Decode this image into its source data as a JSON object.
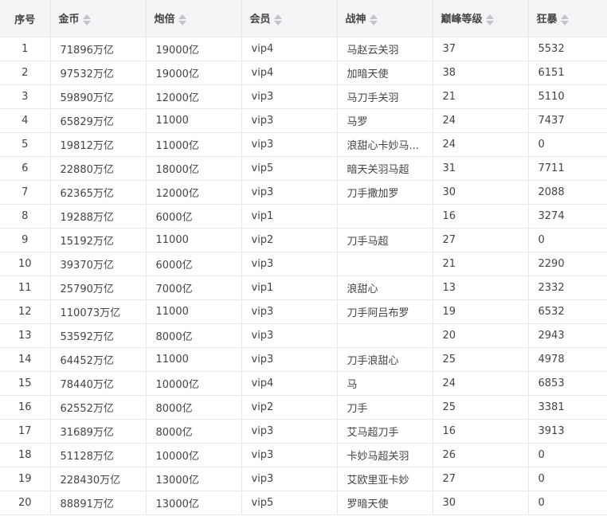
{
  "table": {
    "columns": [
      {
        "label": "序号",
        "sortable": false
      },
      {
        "label": "金币",
        "sortable": true
      },
      {
        "label": "炮倍",
        "sortable": true
      },
      {
        "label": "会员",
        "sortable": true
      },
      {
        "label": "战神",
        "sortable": true
      },
      {
        "label": "巅峰等级",
        "sortable": true
      },
      {
        "label": "狂暴",
        "sortable": true
      }
    ],
    "rows": [
      [
        "1",
        "71896万亿",
        "19000亿",
        "vip4",
        "马赵云关羽",
        "37",
        "5532"
      ],
      [
        "2",
        "97532万亿",
        "19000亿",
        "vip4",
        "加暗天使",
        "38",
        "6151"
      ],
      [
        "3",
        "59890万亿",
        "12000亿",
        "vip3",
        "马刀手关羽",
        "21",
        "5110"
      ],
      [
        "4",
        "65829万亿",
        "11000",
        "vip3",
        "马罗",
        "24",
        "7437"
      ],
      [
        "5",
        "19812万亿",
        "11000亿",
        "vip3",
        "浪甜心卡妙马...",
        "24",
        "0"
      ],
      [
        "6",
        "22880万亿",
        "18000亿",
        "vip5",
        "暗天关羽马超",
        "31",
        "7711"
      ],
      [
        "7",
        "62365万亿",
        "12000亿",
        "vip3",
        "刀手撒加罗",
        "30",
        "2088"
      ],
      [
        "8",
        "19288万亿",
        "6000亿",
        "vip1",
        "",
        "16",
        "3274"
      ],
      [
        "9",
        "15192万亿",
        "11000",
        "vip2",
        "刀手马超",
        "27",
        "0"
      ],
      [
        "10",
        "39370万亿",
        "6000亿",
        "vip3",
        "",
        "21",
        "2290"
      ],
      [
        "11",
        "25790万亿",
        "7000亿",
        "vip1",
        "浪甜心",
        "13",
        "2332"
      ],
      [
        "12",
        "110073万亿",
        "11000",
        "vip3",
        "刀手阿吕布罗",
        "19",
        "6532"
      ],
      [
        "13",
        "53592万亿",
        "8000亿",
        "vip3",
        "",
        "20",
        "2943"
      ],
      [
        "14",
        "64452万亿",
        "11000",
        "vip3",
        "刀手浪甜心",
        "25",
        "4978"
      ],
      [
        "15",
        "78440万亿",
        "10000亿",
        "vip4",
        "马",
        "24",
        "6853"
      ],
      [
        "16",
        "62552万亿",
        "8000亿",
        "vip2",
        "刀手",
        "25",
        "3381"
      ],
      [
        "17",
        "31689万亿",
        "8000亿",
        "vip3",
        "艾马超刀手",
        "16",
        "3913"
      ],
      [
        "18",
        "51128万亿",
        "10000亿",
        "vip3",
        "卡妙马超关羽",
        "26",
        "0"
      ],
      [
        "19",
        "228430万亿",
        "13000亿",
        "vip3",
        "艾欧里亚卡妙",
        "27",
        "0"
      ],
      [
        "20",
        "88891万亿",
        "13000亿",
        "vip5",
        "罗暗天使",
        "30",
        "0"
      ]
    ]
  }
}
